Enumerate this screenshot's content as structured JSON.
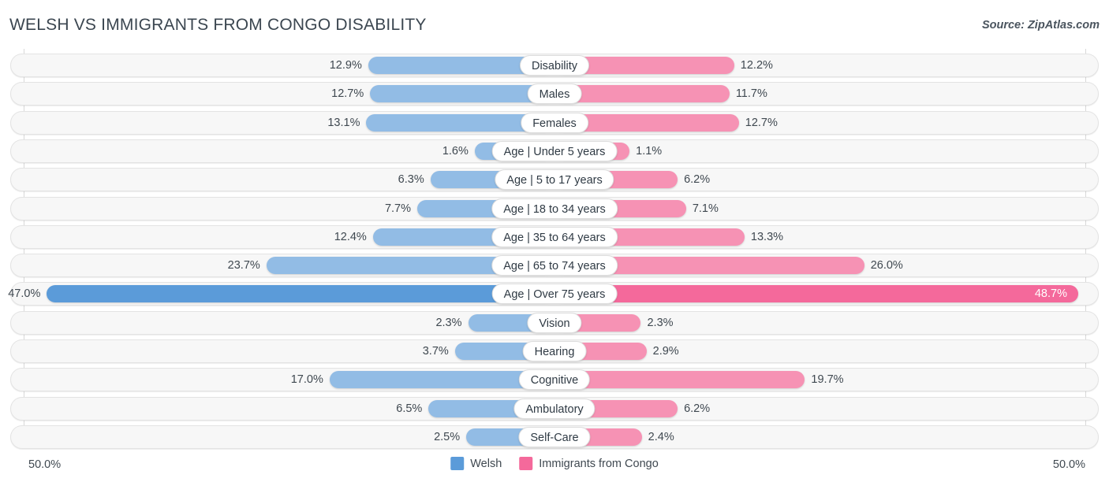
{
  "header": {
    "title": "WELSH VS IMMIGRANTS FROM CONGO DISABILITY",
    "source": "Source: ZipAtlas.com"
  },
  "axis": {
    "left_label": "50.0%",
    "right_label": "50.0%"
  },
  "legend": {
    "items": [
      {
        "label": "Welsh",
        "color": "#5b9bd9",
        "swatch": "blue"
      },
      {
        "label": "Immigrants from Congo",
        "color": "#f4699b",
        "swatch": "pink"
      }
    ]
  },
  "colors": {
    "left_bar": "#92bce5",
    "right_bar": "#f692b4",
    "left_bar_highlight": "#5b9bd9",
    "right_bar_highlight": "#f4699b",
    "track": "#f7f7f7",
    "text": "#3f4850"
  },
  "chart_data": {
    "type": "bar",
    "title": "WELSH VS IMMIGRANTS FROM CONGO DISABILITY",
    "subtitle": "",
    "xlabel": "",
    "ylabel": "",
    "orientation": "horizontal-diverging",
    "axis_max_percent": 50.0,
    "xlim": [
      -50.0,
      50.0
    ],
    "grid": true,
    "legend_position": "bottom-center",
    "categories": [
      "Disability",
      "Males",
      "Females",
      "Age | Under 5 years",
      "Age | 5 to 17 years",
      "Age | 18 to 34 years",
      "Age | 35 to 64 years",
      "Age | 65 to 74 years",
      "Age | Over 75 years",
      "Vision",
      "Hearing",
      "Cognitive",
      "Ambulatory",
      "Self-Care"
    ],
    "series": [
      {
        "name": "Welsh",
        "side": "left",
        "color": "#92bce5",
        "values": [
          12.9,
          12.7,
          13.1,
          1.6,
          6.3,
          7.7,
          12.4,
          23.7,
          47.0,
          2.3,
          3.7,
          17.0,
          6.5,
          2.5
        ],
        "labels": [
          "12.9%",
          "12.7%",
          "13.1%",
          "1.6%",
          "6.3%",
          "7.7%",
          "12.4%",
          "23.7%",
          "47.0%",
          "2.3%",
          "3.7%",
          "17.0%",
          "6.5%",
          "2.5%"
        ]
      },
      {
        "name": "Immigrants from Congo",
        "side": "right",
        "color": "#f692b4",
        "values": [
          12.2,
          11.7,
          12.7,
          1.1,
          6.2,
          7.1,
          13.3,
          26.0,
          48.7,
          2.3,
          2.9,
          19.7,
          6.2,
          2.4
        ],
        "labels": [
          "12.2%",
          "11.7%",
          "12.7%",
          "1.1%",
          "6.2%",
          "7.1%",
          "13.3%",
          "26.0%",
          "48.7%",
          "2.3%",
          "2.9%",
          "19.7%",
          "6.2%",
          "2.4%"
        ]
      }
    ],
    "highlight_rows": [
      8
    ]
  },
  "rows": [
    {
      "label": "Disability",
      "left": "12.9%",
      "right": "12.2%",
      "lv": 12.9,
      "rv": 12.2,
      "hi": false
    },
    {
      "label": "Males",
      "left": "12.7%",
      "right": "11.7%",
      "lv": 12.7,
      "rv": 11.7,
      "hi": false
    },
    {
      "label": "Females",
      "left": "13.1%",
      "right": "12.7%",
      "lv": 13.1,
      "rv": 12.7,
      "hi": false
    },
    {
      "label": "Age | Under 5 years",
      "left": "1.6%",
      "right": "1.1%",
      "lv": 1.6,
      "rv": 1.1,
      "hi": false
    },
    {
      "label": "Age | 5 to 17 years",
      "left": "6.3%",
      "right": "6.2%",
      "lv": 6.3,
      "rv": 6.2,
      "hi": false
    },
    {
      "label": "Age | 18 to 34 years",
      "left": "7.7%",
      "right": "7.1%",
      "lv": 7.7,
      "rv": 7.1,
      "hi": false
    },
    {
      "label": "Age | 35 to 64 years",
      "left": "12.4%",
      "right": "13.3%",
      "lv": 12.4,
      "rv": 13.3,
      "hi": false
    },
    {
      "label": "Age | 65 to 74 years",
      "left": "23.7%",
      "right": "26.0%",
      "lv": 23.7,
      "rv": 26.0,
      "hi": false
    },
    {
      "label": "Age | Over 75 years",
      "left": "47.0%",
      "right": "48.7%",
      "lv": 47.0,
      "rv": 48.7,
      "hi": true
    },
    {
      "label": "Vision",
      "left": "2.3%",
      "right": "2.3%",
      "lv": 2.3,
      "rv": 2.3,
      "hi": false
    },
    {
      "label": "Hearing",
      "left": "3.7%",
      "right": "2.9%",
      "lv": 3.7,
      "rv": 2.9,
      "hi": false
    },
    {
      "label": "Cognitive",
      "left": "17.0%",
      "right": "19.7%",
      "lv": 17.0,
      "rv": 19.7,
      "hi": false
    },
    {
      "label": "Ambulatory",
      "left": "6.5%",
      "right": "6.2%",
      "lv": 6.5,
      "rv": 6.2,
      "hi": false
    },
    {
      "label": "Self-Care",
      "left": "2.5%",
      "right": "2.4%",
      "lv": 2.5,
      "rv": 2.4,
      "hi": false
    }
  ]
}
